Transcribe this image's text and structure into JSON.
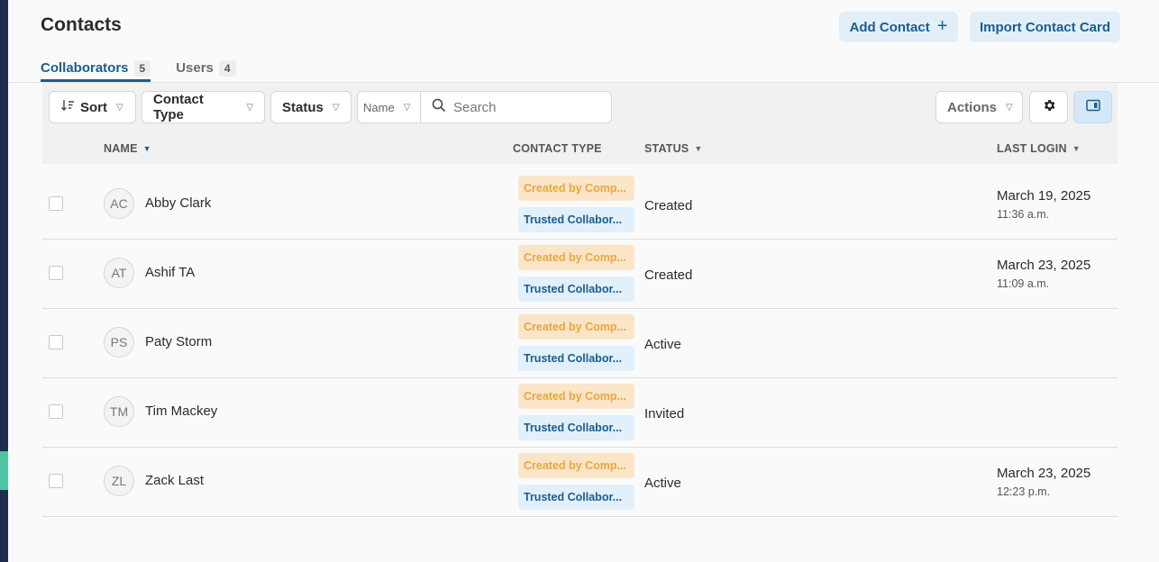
{
  "page": {
    "title": "Contacts"
  },
  "header": {
    "add_contact_label": "Add Contact",
    "import_label": "Import Contact Card"
  },
  "tabs": [
    {
      "label": "Collaborators",
      "count": "5",
      "active": true
    },
    {
      "label": "Users",
      "count": "4",
      "active": false
    }
  ],
  "toolbar": {
    "sort_label": "Sort",
    "contact_type_label": "Contact Type",
    "status_label": "Status",
    "search_field_label": "Name",
    "search_placeholder": "Search",
    "actions_label": "Actions"
  },
  "columns": {
    "name": "NAME",
    "contact_type": "CONTACT TYPE",
    "status": "STATUS",
    "last_login": "LAST LOGIN"
  },
  "rows": [
    {
      "initials": "AC",
      "name": "Abby Clark",
      "tag1": "Created by Comp...",
      "tag2": "Trusted Collabor...",
      "status": "Created",
      "login_date": "March 19, 2025",
      "login_time": "11:36 a.m."
    },
    {
      "initials": "AT",
      "name": "Ashif TA",
      "tag1": "Created by Comp...",
      "tag2": "Trusted Collabor...",
      "status": "Created",
      "login_date": "March 23, 2025",
      "login_time": "11:09 a.m."
    },
    {
      "initials": "PS",
      "name": "Paty Storm",
      "tag1": "Created by Comp...",
      "tag2": "Trusted Collabor...",
      "status": "Active",
      "login_date": "",
      "login_time": ""
    },
    {
      "initials": "TM",
      "name": "Tim Mackey",
      "tag1": "Created by Comp...",
      "tag2": "Trusted Collabor...",
      "status": "Invited",
      "login_date": "",
      "login_time": ""
    },
    {
      "initials": "ZL",
      "name": "Zack Last",
      "tag1": "Created by Comp...",
      "tag2": "Trusted Collabor...",
      "status": "Active",
      "login_date": "March 23, 2025",
      "login_time": "12:23 p.m."
    }
  ],
  "colors": {
    "brand": "#1a5e8c",
    "rail": "#1f2d4d",
    "rail_accent": "#4fc4a3",
    "tag_created_bg": "#fbe5c9",
    "tag_created_text": "#e8a83d",
    "tag_trusted_bg": "#e2f0fb"
  },
  "icons": {
    "add": "plus-icon",
    "sort": "sort-icon",
    "search": "search-icon",
    "settings": "gear-icon",
    "panel": "side-panel-icon"
  }
}
